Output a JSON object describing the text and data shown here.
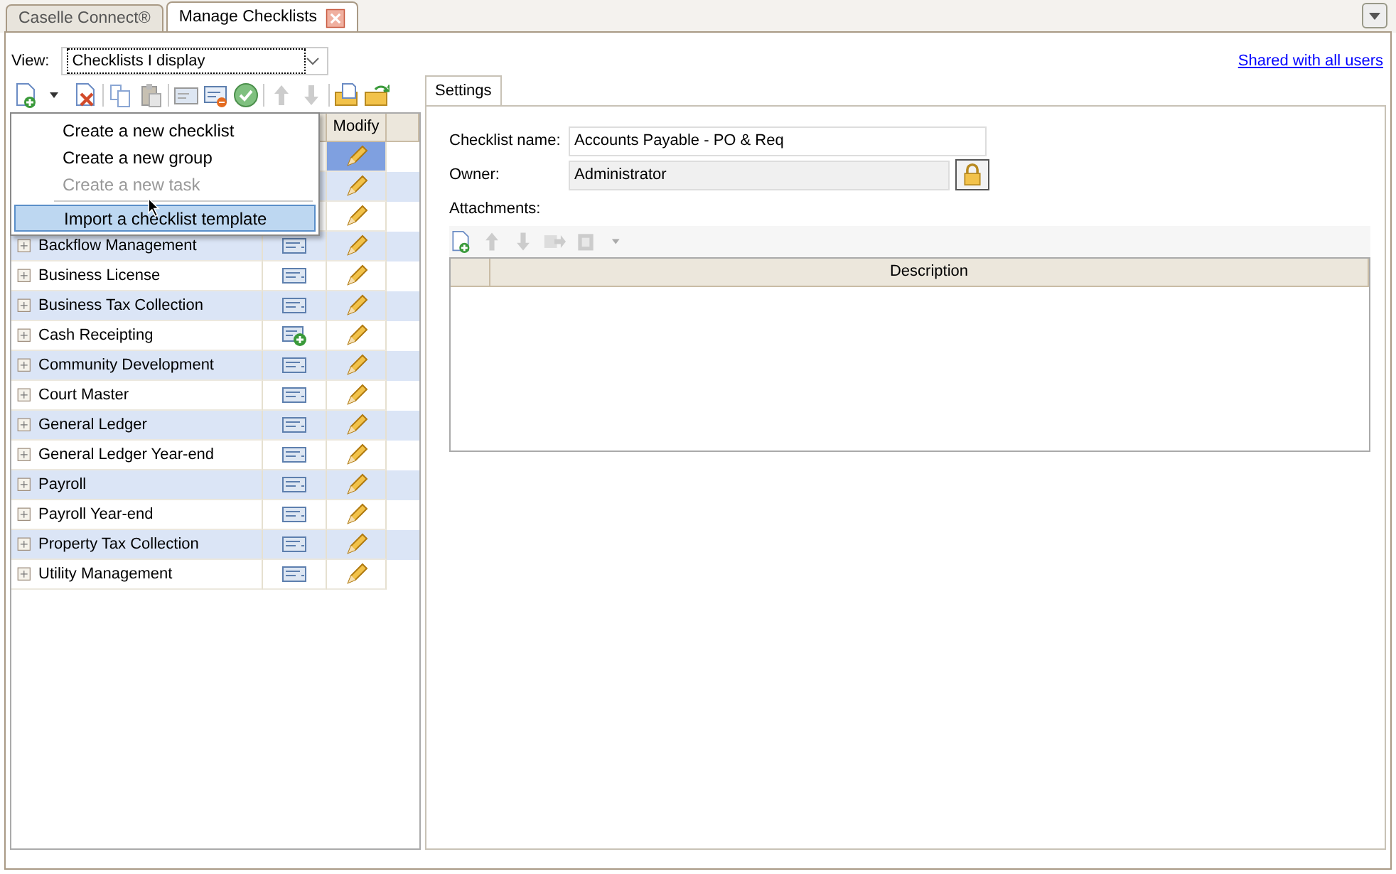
{
  "tabs": [
    {
      "label": "Caselle Connect®",
      "selected": false,
      "closable": false
    },
    {
      "label": "Manage Checklists",
      "selected": true,
      "closable": true
    }
  ],
  "view": {
    "label": "View:",
    "value": "Checklists I display"
  },
  "shared_link": "Shared with all users",
  "menu": {
    "items": [
      {
        "label": "Create a new checklist",
        "disabled": false,
        "selected": false
      },
      {
        "label": "Create a new group",
        "disabled": false,
        "selected": false
      },
      {
        "label": "Create a new task",
        "disabled": true,
        "selected": false
      },
      {
        "label": "Import a checklist template",
        "disabled": false,
        "selected": true
      }
    ]
  },
  "tree": {
    "columns": [
      "Modify"
    ],
    "rows": [
      {
        "selected": true
      },
      {
        "selected": false
      },
      {
        "selected": false
      },
      {
        "name": "Backflow Management",
        "kind": "checklist",
        "selected": false
      },
      {
        "name": "Business License",
        "kind": "checklist",
        "selected": false
      },
      {
        "name": "Business Tax Collection",
        "kind": "checklist",
        "selected": false
      },
      {
        "name": "Cash Receipting",
        "kind": "checklist-add",
        "selected": false
      },
      {
        "name": "Community Development",
        "kind": "checklist",
        "selected": false
      },
      {
        "name": "Court Master",
        "kind": "checklist",
        "selected": false
      },
      {
        "name": "General Ledger",
        "kind": "checklist",
        "selected": false
      },
      {
        "name": "General Ledger Year-end",
        "kind": "checklist",
        "selected": false
      },
      {
        "name": "Payroll",
        "kind": "checklist",
        "selected": false
      },
      {
        "name": "Payroll Year-end",
        "kind": "checklist",
        "selected": false
      },
      {
        "name": "Property Tax Collection",
        "kind": "checklist",
        "selected": false
      },
      {
        "name": "Utility Management",
        "kind": "checklist",
        "selected": false
      }
    ]
  },
  "settings": {
    "tab": "Settings",
    "name_label": "Checklist name:",
    "name_value": "Accounts Payable - PO & Req",
    "owner_label": "Owner:",
    "owner_value": "Administrator",
    "attachments_label": "Attachments:",
    "attachments_columns": [
      "Description"
    ]
  }
}
